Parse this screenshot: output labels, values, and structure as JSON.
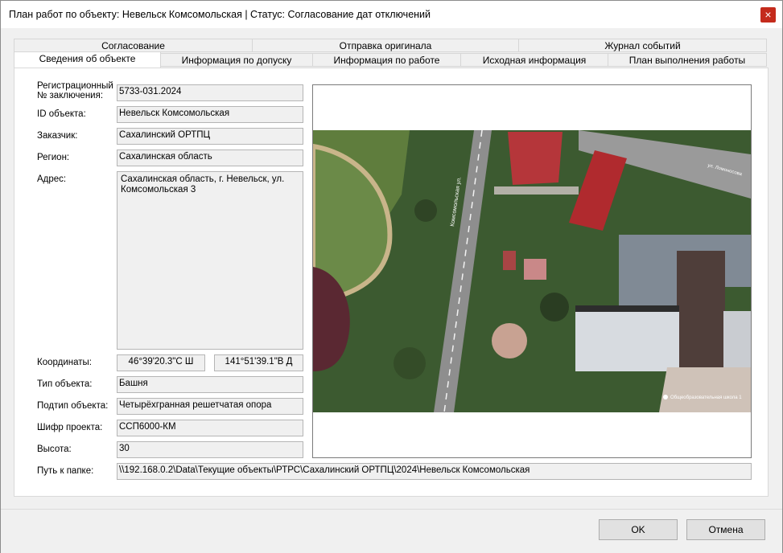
{
  "window": {
    "title": "План работ по объекту: Невельск Комсомольская | Статус: Согласование дат отключений",
    "close_glyph": "×"
  },
  "tabs_row1": [
    "Согласование",
    "Отправка оригинала",
    "Журнал событий"
  ],
  "tabs_row2": [
    "Сведения об объекте",
    "Информация по допуску",
    "Информация по работе",
    "Исходная информация",
    "План выполнения работы"
  ],
  "active_tab": "Сведения об объекте",
  "form": {
    "reg_label": "Регистрационный\n№ заключения:",
    "reg_value": "5733-031.2024",
    "id_label": "ID объекта:",
    "id_value": "Невельск Комсомольская",
    "customer_label": "Заказчик:",
    "customer_value": "Сахалинский ОРТПЦ",
    "region_label": "Регион:",
    "region_value": "Сахалинская область",
    "address_label": "Адрес:",
    "address_value": "Сахалинская область, г. Невельск, ул.\nКомсомольская 3",
    "coords_label": "Координаты:",
    "lat_value": "46°39'20.3\"С Ш",
    "lon_value": "141°51'39.1\"В Д",
    "type_label": "Тип объекта:",
    "type_value": "Башня",
    "subtype_label": "Подтип объекта:",
    "subtype_value": "Четырёхгранная решетчатая опора",
    "cipher_label": "Шифр проекта:",
    "cipher_value": "ССП6000-КМ",
    "height_label": "Высота:",
    "height_value": "30",
    "path_label": "Путь к папке:",
    "path_value": "\\\\192.168.0.2\\Data\\Текущие объекты\\РТРС\\Сахалинский ОРТПЦ\\2024\\Невельск Комсомольская"
  },
  "map": {
    "street_label": "Комсомольская ул.",
    "street_label_2": "ул. Ломоносова",
    "poi_label": "Общеобразовательная школа 1"
  },
  "buttons": {
    "ok": "OK",
    "cancel": "Отмена"
  }
}
